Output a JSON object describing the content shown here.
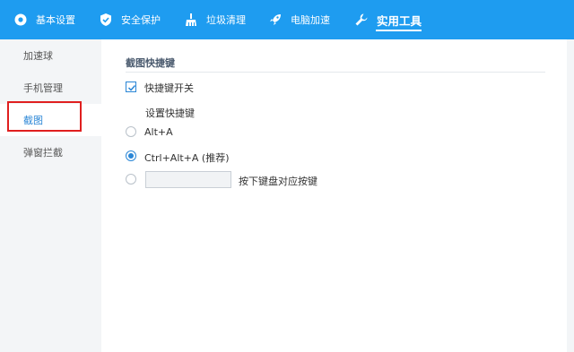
{
  "nav": {
    "items": [
      {
        "label": "基本设置",
        "icon": "gear-icon"
      },
      {
        "label": "安全保护",
        "icon": "shield-icon"
      },
      {
        "label": "垃圾清理",
        "icon": "broom-icon"
      },
      {
        "label": "电脑加速",
        "icon": "rocket-icon"
      },
      {
        "label": "实用工具",
        "icon": "wrench-icon",
        "active": true
      }
    ],
    "bg_color": "#1e9cf0"
  },
  "sidebar": {
    "items": [
      {
        "label": "加速球"
      },
      {
        "label": "手机管理"
      },
      {
        "label": "截图",
        "active": true
      },
      {
        "label": "弹窗拦截"
      }
    ]
  },
  "content": {
    "section_title": "截图快捷键",
    "shortcut_toggle": {
      "label": "快捷键开关",
      "checked": true
    },
    "set_shortcut_label": "设置快捷键",
    "options": [
      {
        "label": "Alt+A",
        "checked": false
      },
      {
        "label": "Ctrl+Alt+A (推荐)",
        "checked": true
      },
      {
        "label": "",
        "checked": false
      }
    ],
    "custom_input": {
      "value": "",
      "hint": "按下键盘对应按键"
    }
  },
  "colors": {
    "accent": "#2a86d6",
    "highlight": "#e01f1f"
  }
}
